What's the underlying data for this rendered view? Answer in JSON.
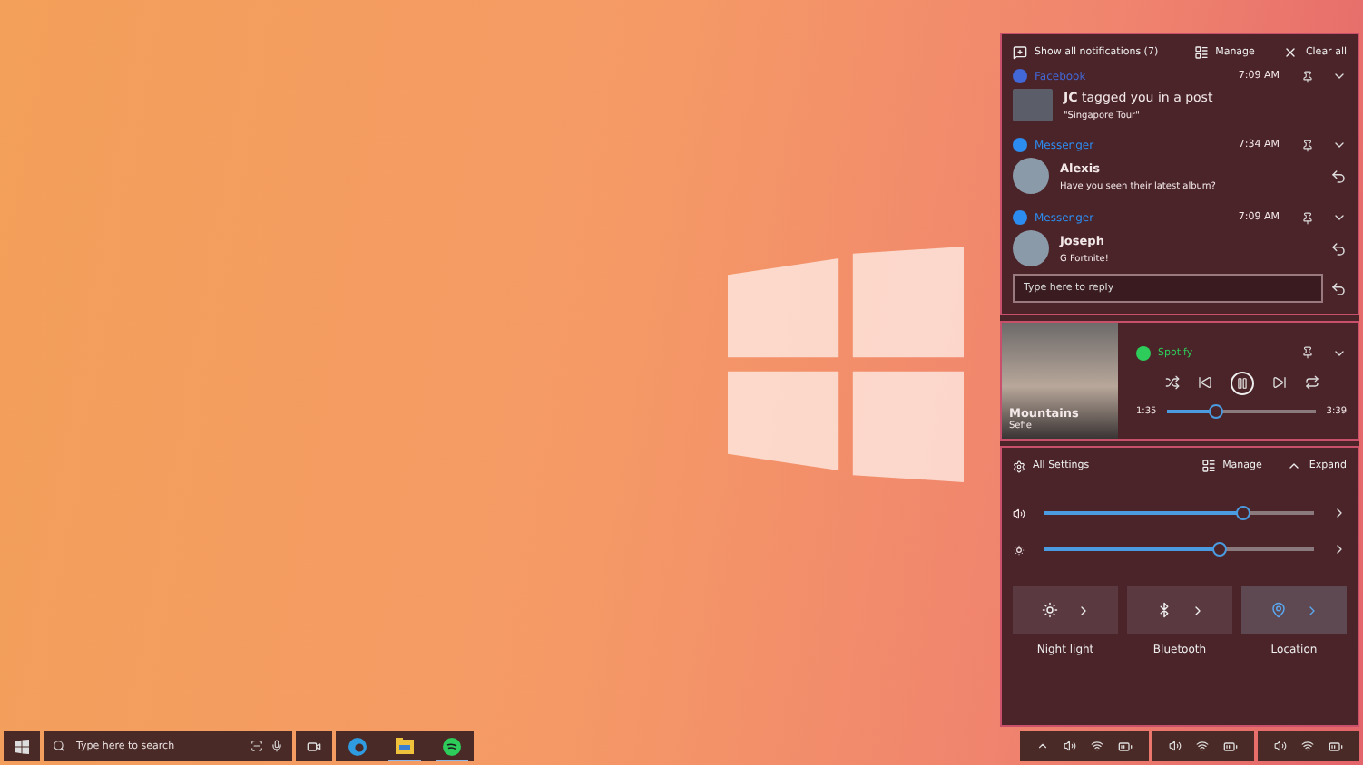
{
  "action_center": {
    "show_all": "Show all notifications (7)",
    "manage": "Manage",
    "clear_all": "Clear all"
  },
  "notifications": [
    {
      "kind": "post",
      "app": "Facebook",
      "color": "#4267d6",
      "time": "7:09 AM",
      "title": "**JC** tagged you in a post",
      "body": "\"Singapore Tour\""
    },
    {
      "kind": "message",
      "app": "Messenger",
      "color": "#2d8cf0",
      "time": "7:34 AM",
      "title": "Alexis",
      "body": "Have you seen their latest album?"
    },
    {
      "kind": "message",
      "app": "Messenger",
      "color": "#2d8cf0",
      "time": "7:09 AM",
      "title": "Joseph",
      "body": "G Fortnite!"
    }
  ],
  "reply": {
    "placeholder": "Type here to reply"
  },
  "media": {
    "app": "Spotify",
    "title": "Mountains",
    "artist": "Sefie",
    "playing": true,
    "elapsed": "1:35",
    "total": "3:39",
    "level": 0.33
  },
  "quick_settings": {
    "all_settings": "All Settings",
    "manage": "Manage",
    "expand": "Expand",
    "sliders": [
      {
        "kind": "volume",
        "level": 0.74
      },
      {
        "kind": "brightness",
        "level": 0.65
      }
    ],
    "tiles": [
      {
        "kind": "night",
        "label": "Night light",
        "on": false
      },
      {
        "kind": "bluetooth",
        "label": "Bluetooth",
        "on": false
      },
      {
        "kind": "location",
        "label": "Location",
        "on": true
      }
    ]
  },
  "taskbar": {
    "search_placeholder": "Type here to search",
    "apps": [
      {
        "kind": "browser",
        "running": false
      },
      {
        "kind": "files",
        "running": true
      },
      {
        "kind": "music",
        "running": true
      }
    ]
  }
}
